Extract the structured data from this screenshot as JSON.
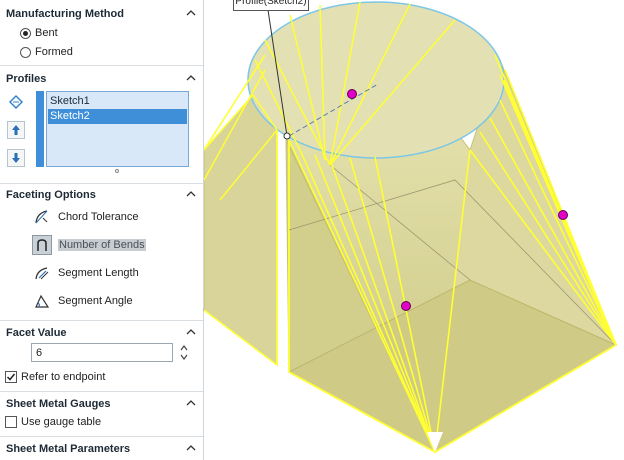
{
  "panel": {
    "manufacturing": {
      "title": "Manufacturing Method",
      "options": [
        {
          "label": "Bent",
          "selected": true
        },
        {
          "label": "Formed",
          "selected": false
        }
      ]
    },
    "profiles": {
      "title": "Profiles",
      "items": [
        {
          "label": "Sketch1",
          "selected": false
        },
        {
          "label": "Sketch2",
          "selected": true
        }
      ]
    },
    "faceting": {
      "title": "Faceting Options",
      "options": [
        {
          "label": "Chord Tolerance",
          "icon": "chord-tolerance-icon",
          "active": false
        },
        {
          "label": "Number of Bends",
          "icon": "number-of-bends-icon",
          "active": true
        },
        {
          "label": "Segment Length",
          "icon": "segment-length-icon",
          "active": false
        },
        {
          "label": "Segment Angle",
          "icon": "segment-angle-icon",
          "active": false
        }
      ]
    },
    "facet_value": {
      "title": "Facet Value",
      "value": "6",
      "refer_label": "Refer to endpoint",
      "refer_checked": true
    },
    "gauges": {
      "title": "Sheet Metal Gauges",
      "use_gauge_label": "Use gauge table",
      "use_gauge_checked": false
    },
    "parameters": {
      "title": "Sheet Metal Parameters"
    }
  },
  "viewport": {
    "callout_label": "Profile(Sketch2)"
  },
  "colors": {
    "accent": "#3f8fd8",
    "face": "#d9d69c",
    "edge": "#ffff33",
    "handle": "#e000c8"
  }
}
